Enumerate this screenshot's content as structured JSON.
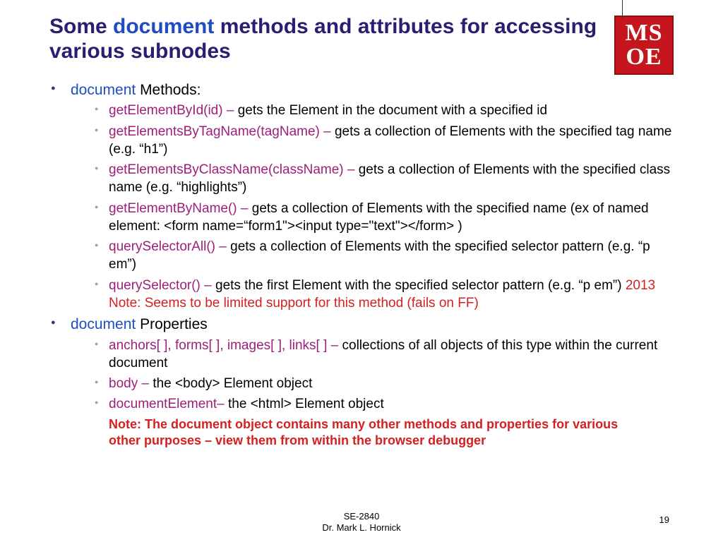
{
  "title": {
    "pre": "Some ",
    "keyword": "document",
    "post": " methods and attributes for accessing various subnodes"
  },
  "logo": {
    "line1": "MS",
    "line2": "OE"
  },
  "sections": [
    {
      "label_kw": "document",
      "label_rest": " Methods:",
      "items": [
        {
          "code": "getElementById(id) – ",
          "desc": "gets the Element in the document with a specified id",
          "note": ""
        },
        {
          "code": "getElementsByTagName(tagName) – ",
          "desc": "gets a collection of Elements with the specified tag name (e.g. “h1”)",
          "note": ""
        },
        {
          "code": "getElementsByClassName(className) – ",
          "desc": "gets a collection of Elements with the specified class name (e.g. “highlights”)",
          "note": ""
        },
        {
          "code": "getElementByName() – ",
          "desc": "gets a collection of Elements with the specified name (ex of named element: <form name=“form1\"><input type=\"text\"></form> )",
          "note": ""
        },
        {
          "code": "querySelectorAll() – ",
          "desc": "gets a collection of Elements with the specified selector pattern (e.g. “p em”)",
          "note": ""
        },
        {
          "code": "querySelector() – ",
          "desc": "gets the first Element with the specified selector pattern (e.g. “p em”) ",
          "note": "2013 Note: Seems to be limited support for this method (fails on FF)"
        }
      ]
    },
    {
      "label_kw": "document",
      "label_rest": " Properties",
      "items": [
        {
          "code": "anchors[ ], forms[ ], images[ ], links[ ] – ",
          "desc": "collections of all objects of this type within the current document",
          "note": ""
        },
        {
          "code": "body – ",
          "desc": "the <body> Element object",
          "note": ""
        },
        {
          "code": "documentElement– ",
          "desc": "the <html> Element object",
          "note": ""
        }
      ]
    }
  ],
  "bottom_note": "Note: The document object contains many other methods and properties for various other purposes – view them from within the browser debugger",
  "footer": {
    "line1": "SE-2840",
    "line2": "Dr. Mark L. Hornick"
  },
  "page_number": "19"
}
